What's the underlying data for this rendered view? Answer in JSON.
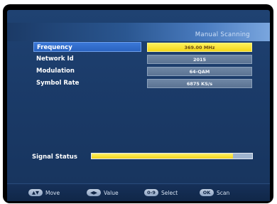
{
  "screen": {
    "title": "Manual Scanning"
  },
  "rows": [
    {
      "label": "Frequency",
      "value": "369.00 MHz"
    },
    {
      "label": "Network Id",
      "value": "2015"
    },
    {
      "label": "Modulation",
      "value": "64-QAM"
    },
    {
      "label": "Symbol Rate",
      "value": "6875 KS/s"
    }
  ],
  "signal": {
    "label": "Signal Status",
    "level_fraction": 0.88
  },
  "footer": {
    "hints": [
      {
        "key": "▲▼",
        "label": "Move"
      },
      {
        "key": "◀▶",
        "label": "Value"
      },
      {
        "key": "0-9",
        "label": "Select"
      },
      {
        "key": "OK",
        "label": "Scan"
      }
    ]
  }
}
